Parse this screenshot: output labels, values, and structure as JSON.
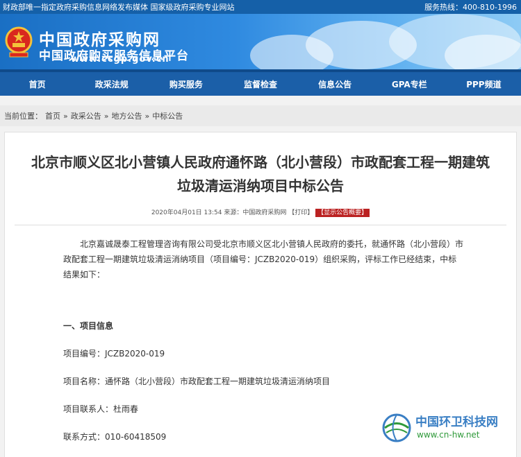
{
  "topbar": {
    "left": "财政部唯一指定政府采购信息网络发布媒体 国家级政府采购专业网站",
    "right": "服务热线：400-810-1996"
  },
  "brand": {
    "line1": "中国政府采购网",
    "line2": "中国政府购买服务信息平台",
    "url": "www.ccgp.gov.cn"
  },
  "nav": {
    "items": [
      "首页",
      "政采法规",
      "购买服务",
      "监督检查",
      "信息公告",
      "GPA专栏",
      "PPP频道"
    ]
  },
  "breadcrumb": {
    "prefix": "当前位置：",
    "items": [
      "首页",
      "»",
      "政采公告",
      "»",
      "地方公告",
      "»",
      "中标公告"
    ]
  },
  "article": {
    "title": "北京市顺义区北小营镇人民政府通怀路（北小营段）市政配套工程一期建筑垃圾清运消纳项目中标公告",
    "meta_date": "2020年04月01日 13:54",
    "meta_source": "来源：中国政府采购网",
    "meta_print": "【打印】",
    "meta_tag": "【显示公告概要】",
    "intro": "北京嘉诚晟泰工程管理咨询有限公司受北京市顺义区北小营镇人民政府的委托，就通怀路（北小营段）市政配套工程一期建筑垃圾清运消纳项目（项目编号：JCZB2020-019）组织采购，评标工作已经结束，中标结果如下：",
    "section1": "一、项目信息",
    "project_no": "项目编号：JCZB2020-019",
    "project_name": "项目名称：通怀路（北小营段）市政配套工程一期建筑垃圾清运消纳项目",
    "contact_person": "项目联系人：杜雨春",
    "contact_phone": "联系方式：010-60418509"
  },
  "watermark": {
    "name": "中国环卫科技网",
    "url": "www.cn-hw.net"
  },
  "colors": {
    "topbar": "#1560a8",
    "nav": "#1b5fa8",
    "tag": "#b22222",
    "watermark_blue": "#3a7fc4",
    "watermark_green": "#2f9a3a"
  }
}
